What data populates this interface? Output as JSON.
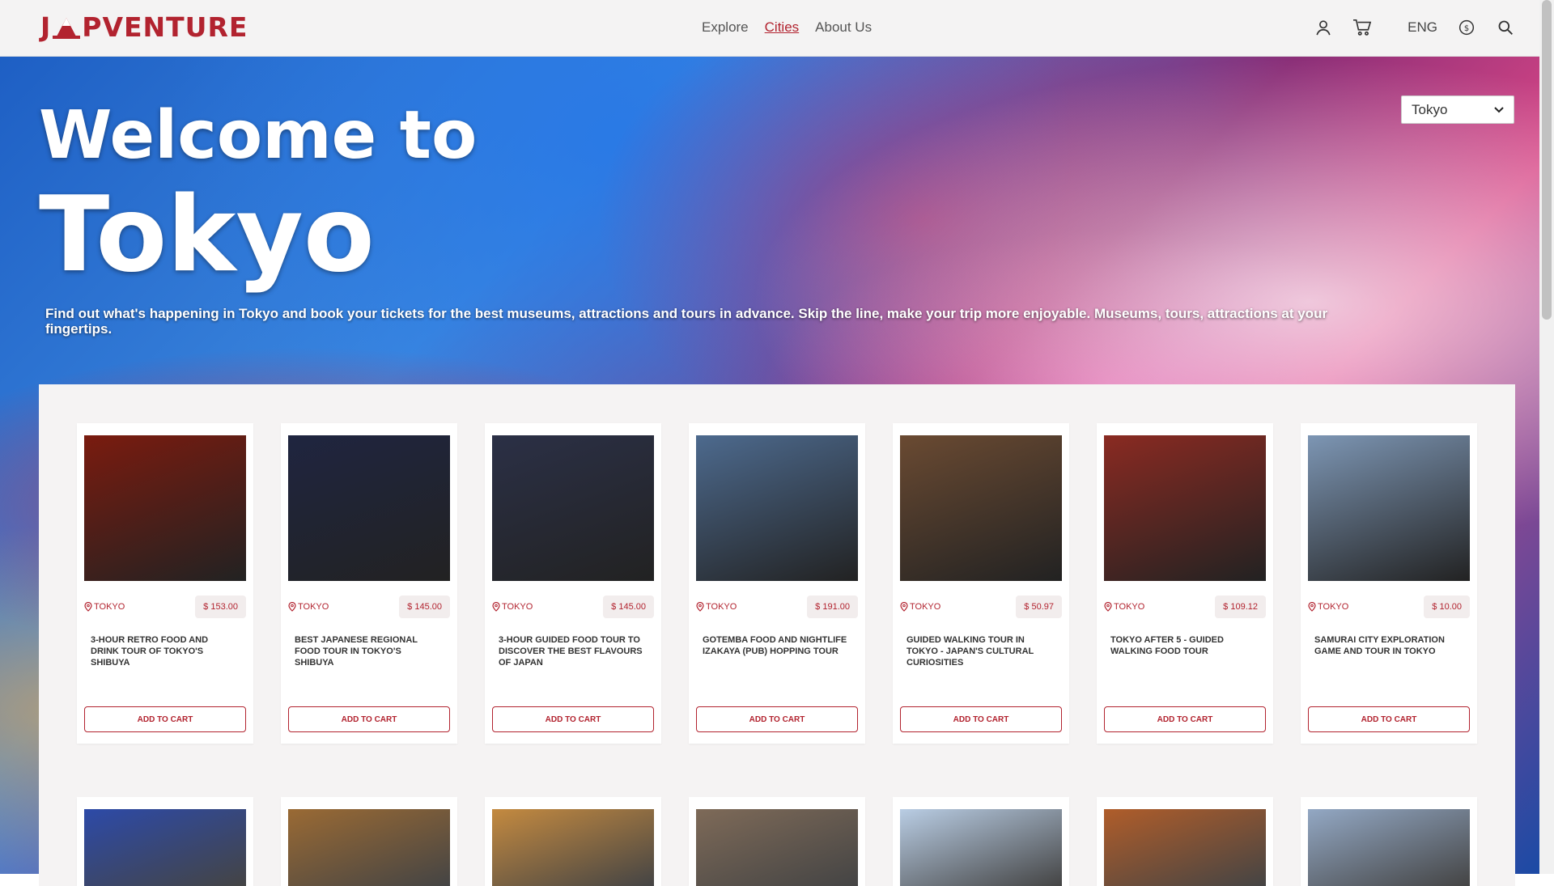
{
  "brand": {
    "name_parts": [
      "J",
      "PVENTURE"
    ]
  },
  "nav": {
    "links": [
      "Explore",
      "Cities",
      "About Us"
    ]
  },
  "header": {
    "lang": "ENG"
  },
  "hero": {
    "title_line1": "Welcome to",
    "title_line2": "Tokyo",
    "description": "Find out what's happening in Tokyo and book your tickets for the best museums, attractions and tours in advance. Skip the line, make your trip more enjoyable. Museums, tours, attractions at your fingertips.",
    "city_select": {
      "value": "Tokyo"
    }
  },
  "cards": [
    {
      "location": "TOKYO",
      "price": "$ 153.00",
      "title": "3-HOUR RETRO FOOD AND DRINK TOUR OF TOKYO'S SHIBUYA",
      "button": "ADD TO CART",
      "color": "#7a1b0f"
    },
    {
      "location": "TOKYO",
      "price": "$ 145.00",
      "title": "BEST JAPANESE REGIONAL FOOD TOUR IN TOKYO'S SHIBUYA",
      "button": "ADD TO CART",
      "color": "#1f2540"
    },
    {
      "location": "TOKYO",
      "price": "$ 145.00",
      "title": "3-HOUR GUIDED FOOD TOUR TO DISCOVER THE BEST FLAVOURS OF JAPAN",
      "button": "ADD TO CART",
      "color": "#2b3046"
    },
    {
      "location": "TOKYO",
      "price": "$ 191.00",
      "title": "GOTEMBA FOOD AND NIGHTLIFE IZAKAYA (PUB) HOPPING TOUR",
      "button": "ADD TO CART",
      "color": "#4d6a8e"
    },
    {
      "location": "TOKYO",
      "price": "$ 50.97",
      "title": "GUIDED WALKING TOUR IN TOKYO - JAPAN'S CULTURAL CURIOSITIES",
      "button": "ADD TO CART",
      "color": "#6a4a32"
    },
    {
      "location": "TOKYO",
      "price": "$ 109.12",
      "title": "TOKYO AFTER 5 - GUIDED WALKING FOOD TOUR",
      "button": "ADD TO CART",
      "color": "#8a2a22"
    },
    {
      "location": "TOKYO",
      "price": "$ 10.00",
      "title": "SAMURAI CITY EXPLORATION GAME AND TOUR IN TOKYO",
      "button": "ADD TO CART",
      "color": "#7d96b4"
    }
  ],
  "cards_row2_colors": [
    "#2d4aa8",
    "#9a6a34",
    "#c48a40",
    "#7e6a58",
    "#b9cde4",
    "#b05d2a",
    "#93a8c4"
  ]
}
